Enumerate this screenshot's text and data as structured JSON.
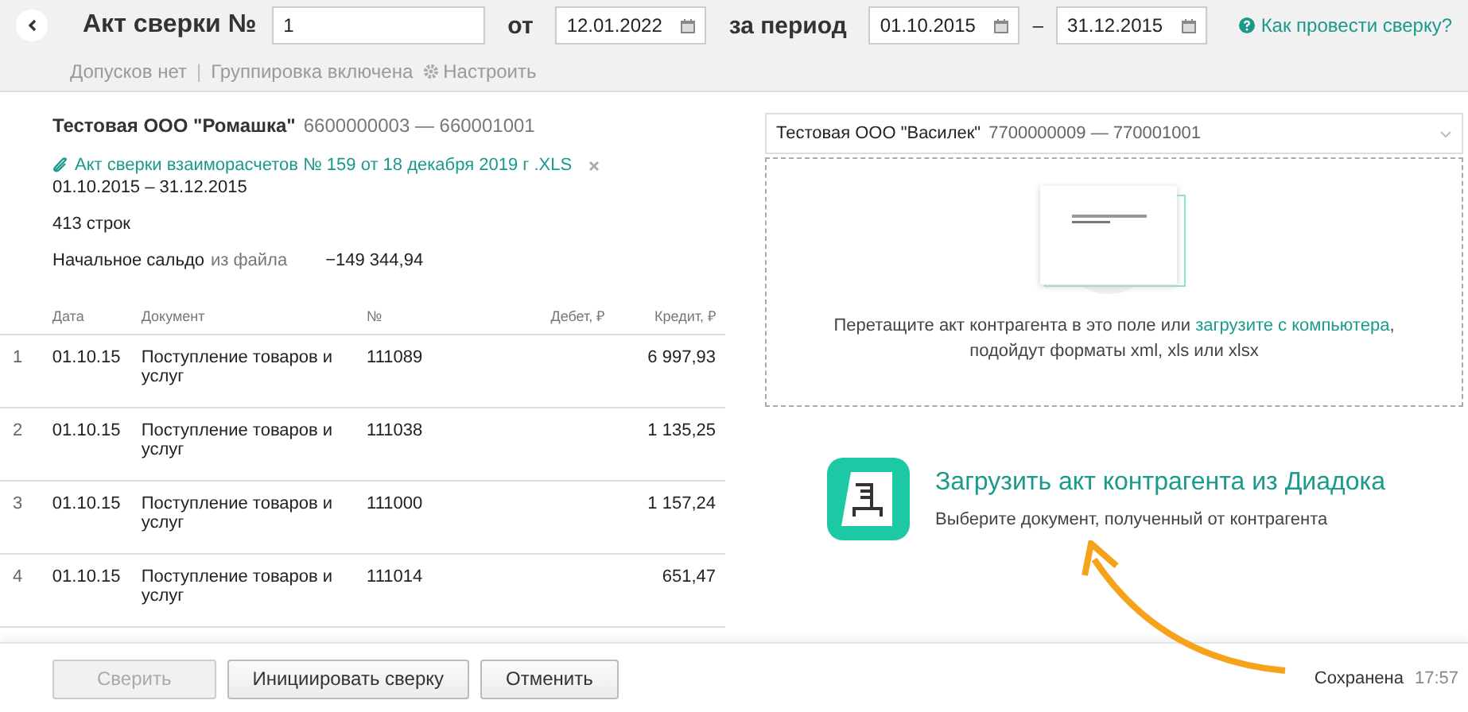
{
  "header": {
    "title": "Акт сверки №",
    "number": {
      "value": "1"
    },
    "date_label": "от",
    "date": {
      "value": "12.01.2022"
    },
    "period_label": "за период",
    "period_from": {
      "value": "01.10.2015"
    },
    "period_dash": "–",
    "period_to": {
      "value": "31.12.2015"
    },
    "help_link": "Как провести сверку?",
    "settings": [
      {
        "kind": "text",
        "label": "Допусков нет"
      },
      {
        "kind": "separator",
        "label": "|"
      },
      {
        "kind": "text",
        "label": "Группировка включена"
      },
      {
        "kind": "gear",
        "label": "Настроить"
      }
    ]
  },
  "own": {
    "company": "Тестовая ООО \"Ромашка\"",
    "codes": "6600000003 — 660001001",
    "file_link": "Акт сверки взаиморасчетов № 159 от 18 декабря 2019 г .XLS",
    "period": "01.10.2015 – 31.12.2015",
    "rows_count": "413 строк",
    "balance_label": "Начальное сальдо",
    "balance_source": "из файла",
    "balance_value": "−149 344,94"
  },
  "table": {
    "columns": [
      "Дата",
      "Документ",
      "№",
      "Дебет, ₽",
      "Кредит, ₽"
    ],
    "rows": [
      {
        "index": "1",
        "date": "01.10.15",
        "document": "Поступление товаров и услуг",
        "number": "111089",
        "debit": "",
        "credit": "6 997,93"
      },
      {
        "index": "2",
        "date": "01.10.15",
        "document": "Поступление товаров и услуг",
        "number": "111038",
        "debit": "",
        "credit": "1 135,25"
      },
      {
        "index": "3",
        "date": "01.10.15",
        "document": "Поступление товаров и услуг",
        "number": "111000",
        "debit": "",
        "credit": "1 157,24"
      },
      {
        "index": "4",
        "date": "01.10.15",
        "document": "Поступление товаров и услуг",
        "number": "111014",
        "debit": "",
        "credit": "651,47"
      }
    ]
  },
  "counterparty": {
    "company": "Тестовая ООО \"Василек\"",
    "codes": "7700000009 — 770001001",
    "drop_text": "Перетащите акт контрагента в это поле или",
    "drop_link": "загрузите с компьютера",
    "drop_text_end": ", подойдут форматы xml, xls или xlsx",
    "diadoc_title": "Загрузить акт контрагента из Диадока",
    "diadoc_subtitle": "Выберите документ, полученный от контрагента"
  },
  "footer": {
    "buttons": [
      {
        "label": "Сверить",
        "disabled": true
      },
      {
        "label": "Инициировать сверку",
        "disabled": false
      },
      {
        "label": "Отменить",
        "disabled": false
      }
    ],
    "status": "Сохранена",
    "time": "17:57"
  }
}
